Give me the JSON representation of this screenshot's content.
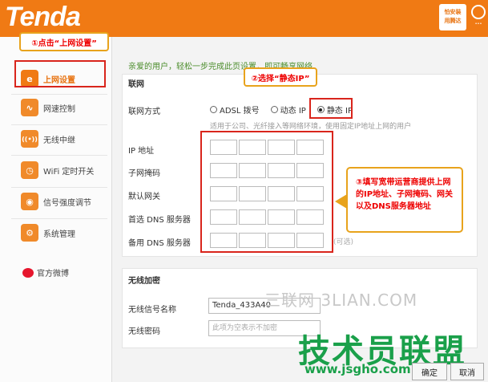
{
  "header": {
    "logo": "Tenda",
    "app_line1": "怕安装",
    "app_line2": "用腾达"
  },
  "sidebar": {
    "items": [
      {
        "label": "上网设置",
        "icon": "internet-icon",
        "glyph": "e"
      },
      {
        "label": "网速控制",
        "icon": "speed-icon",
        "glyph": "∿"
      },
      {
        "label": "无线中继",
        "icon": "relay-icon",
        "glyph": "((•))"
      },
      {
        "label": "WiFi 定时开关",
        "icon": "timer-icon",
        "glyph": "⏱"
      },
      {
        "label": "信号强度调节",
        "icon": "signal-icon",
        "glyph": "◉"
      },
      {
        "label": "系统管理",
        "icon": "settings-icon",
        "glyph": "⚙"
      }
    ],
    "weibo": "官方微博"
  },
  "main": {
    "intro": "亲爱的用户，轻松一步完成此页设置，即可畅享网络",
    "network_title": "联网",
    "mode_label": "联网方式",
    "modes": [
      {
        "label": "ADSL 拨号",
        "checked": false
      },
      {
        "label": "动态 IP",
        "checked": false
      },
      {
        "label": "静态 IP",
        "checked": true
      }
    ],
    "hint": "适用于公司、光纤接入等网络环境，使用固定IP地址上网的用户",
    "fields": {
      "ip": "IP 地址",
      "mask": "子网掩码",
      "gateway": "默认网关",
      "dns1": "首选 DNS 服务器",
      "dns2": "备用 DNS 服务器"
    },
    "optional": "(可选)",
    "wifi_title": "无线加密",
    "ssid_label": "无线信号名称",
    "ssid_value": "Tenda_433A40",
    "pwd_label": "无线密码",
    "pwd_placeholder": "此项为空表示不加密"
  },
  "annotations": {
    "step1": "①点击“上网设置”",
    "step2": "②选择“静态IP”",
    "step3": "③填写宽带运营商提供上网的IP地址、子网掩码、网关以及DNS服务器地址"
  },
  "watermarks": {
    "w1": "三联网 3LIAN.COM",
    "w2": "技术员联盟",
    "w3": "www.jsgho.com"
  },
  "buttons": {
    "ok": "确定",
    "cancel": "取消"
  }
}
